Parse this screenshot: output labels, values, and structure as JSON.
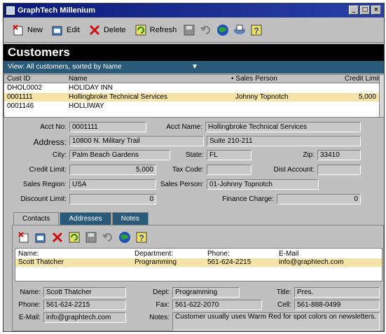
{
  "window": {
    "title": "GraphTech Millenium"
  },
  "toolbar": {
    "new": "New",
    "edit": "Edit",
    "delete": "Delete",
    "refresh": "Refresh"
  },
  "header": {
    "title": "Customers"
  },
  "view": {
    "label": "View: All customers, sorted by Name"
  },
  "grid": {
    "columns": [
      "Cust ID",
      "Name",
      "• Sales Person",
      "Credit Limit"
    ],
    "rows": [
      {
        "id": "DHOL0002",
        "name": "HOLIDAY INN",
        "sales": "",
        "credit": ""
      },
      {
        "id": "0001111",
        "name": "Hollingbroke Technical Services",
        "sales": "Johnny Topnotch",
        "credit": "5,000"
      },
      {
        "id": "0001146",
        "name": "HOLLIWAY",
        "sales": "",
        "credit": ""
      }
    ]
  },
  "detail": {
    "acct_no_label": "Acct No:",
    "acct_no": "0001111",
    "acct_name_label": "Acct Name:",
    "acct_name": "Hollingbroke Technical Services",
    "address_label": "Address:",
    "address1": "10800 N. Military Trail",
    "address2": "Suite 210-211",
    "city_label": "City:",
    "city": "Palm Beach Gardens",
    "state_label": "State:",
    "state": "FL",
    "zip_label": "Zip:",
    "zip": "33410",
    "credit_label": "Credit Limit:",
    "credit": "5,000",
    "taxcode_label": "Tax Code:",
    "taxcode": "",
    "dist_label": "Dist Account:",
    "dist": "",
    "region_label": "Sales Region:",
    "region": "USA",
    "salesperson_label": "Sales Person:",
    "salesperson": "01-Johnny Topnotch",
    "discount_label": "Discount Limit:",
    "discount": "0",
    "finance_label": "Finance Charge:",
    "finance": "0"
  },
  "tabs": [
    "Contacts",
    "Addresses",
    "Notes"
  ],
  "contacts": {
    "columns": [
      "Name:",
      "Department:",
      "Phone:",
      "E-Mail"
    ],
    "rows": [
      {
        "name": "Scott Thatcher",
        "dept": "Programming",
        "phone": "561-624-2215",
        "email": "info@graphtech.com"
      }
    ]
  },
  "contact_detail": {
    "name_label": "Name:",
    "name": "Scott Thatcher",
    "dept_label": "Dept:",
    "dept": "Programming",
    "title_label": "Title:",
    "title": "Pres.",
    "phone_label": "Phone:",
    "phone": "561-624-2215",
    "fax_label": "Fax:",
    "fax": "561-622-2070",
    "cell_label": "Cell:",
    "cell": "561-888-0499",
    "email_label": "E-Mail:",
    "email": "info@graphtech.com",
    "notes_label": "Notes:",
    "notes": "Customer usually uses Warm Red for spot colors on newsletters."
  }
}
